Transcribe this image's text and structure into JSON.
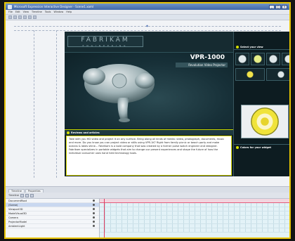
{
  "window": {
    "title": "Microsoft Expression Interactive Designer - Scene1.xaml",
    "controls": [
      "_",
      "□",
      "×"
    ]
  },
  "menu": [
    "File",
    "Edit",
    "View",
    "Timeline",
    "Tools",
    "Window",
    "Help"
  ],
  "artboard": {
    "brand": "FABRIKAM",
    "brand_sub": "ENGINEERING",
    "product_name": "VPR-1000",
    "product_tagline": "Revolution Video Projector",
    "section_about": "Reviews and articles",
    "section_select": "Select your view",
    "section_colors": "Colors for your widget",
    "description": "Take with you HD video and project it on any surface. Bring along all kinds of media: video, photograph, documents, music and more. Do you know you can project video or stills using VPR-1K? Right from family picnic or beach party and make oceans & lakes shine... Fabrikam is a bold company that was created by a former pulse watch engineer and designer. Fabrikam specializes in portable widgets that aim to change our present experiences and shape the future of how the individual consumer uses hand held technology tools."
  },
  "bottom": {
    "tabs": [
      "Timeline",
      "Properties"
    ],
    "timeline_label": "Timeline",
    "objects": [
      "DocumentRoot",
      "(Scene)",
      "Viewport3D",
      "ModelVisual3D",
      "Camera",
      "ProjectorModel",
      "AmbientLight"
    ]
  },
  "colors": {
    "accent": "#e8c400",
    "panel_dark": "#0d1c21",
    "highlight": "#d6e000"
  }
}
